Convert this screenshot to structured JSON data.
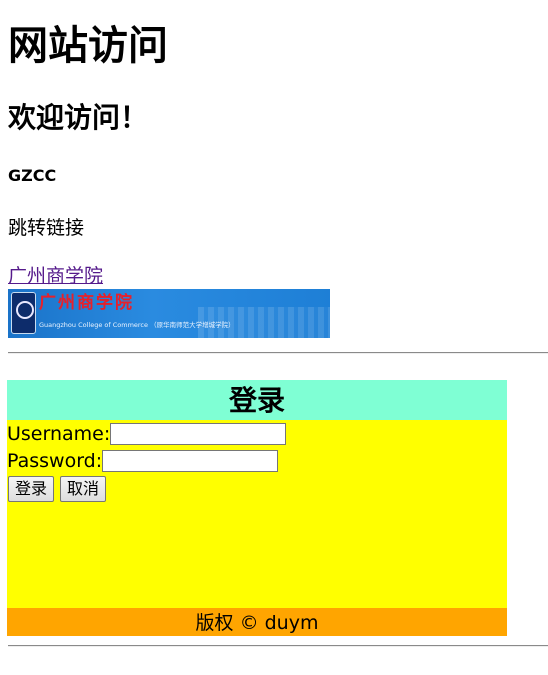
{
  "page": {
    "title": "网站访问",
    "welcome": "欢迎访问！",
    "subtitle": "GZCC",
    "jump_text": "跳转链接",
    "link_text": "广州商学院"
  },
  "logo": {
    "cn_name": "广州商学院",
    "en_name": "Guangzhou College of Commerce （原华南师范大学增城学院）",
    "icon": "college-seal-icon"
  },
  "login": {
    "title": "登录",
    "username_label": "Username:",
    "password_label": "Password:",
    "username_value": "",
    "password_value": "",
    "login_button": "登录",
    "cancel_button": "取消"
  },
  "footer": {
    "copyright": "版权 © duym"
  },
  "colors": {
    "header_bg": "#7fffd4",
    "body_bg": "#ffff00",
    "footer_bg": "#ffa500",
    "link": "#551a8b"
  }
}
